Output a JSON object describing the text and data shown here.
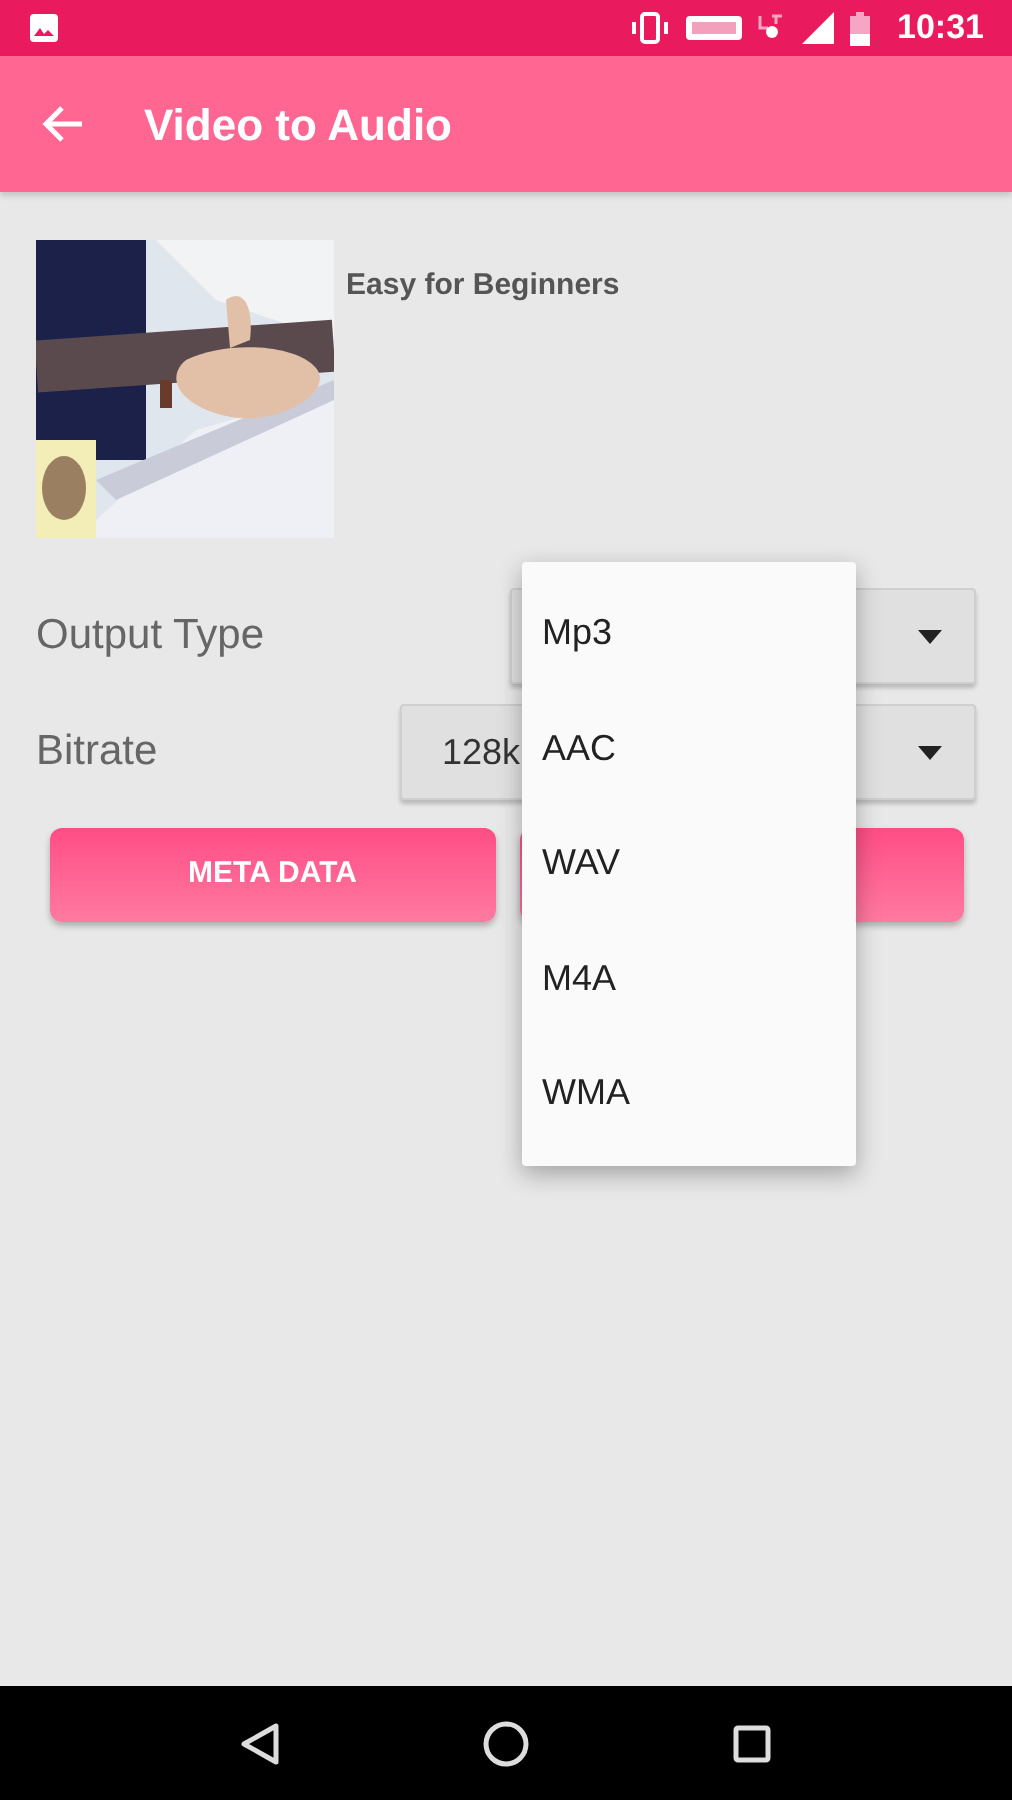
{
  "status_bar": {
    "time": "10:31"
  },
  "app_bar": {
    "title": "Video to Audio"
  },
  "video": {
    "title": "Easy for Beginners"
  },
  "settings": [
    {
      "label": "Output Type"
    },
    {
      "label": "Bitrate",
      "value": "128k"
    }
  ],
  "buttons": [
    {
      "kind": "labeled",
      "label": "META DATA"
    },
    {
      "kind": "covered"
    }
  ],
  "dropdown": {
    "open": true,
    "options": [
      {
        "label": "Mp3"
      },
      {
        "label": "AAC"
      },
      {
        "label": "WAV"
      },
      {
        "label": "M4A"
      },
      {
        "label": "WMA"
      }
    ]
  }
}
